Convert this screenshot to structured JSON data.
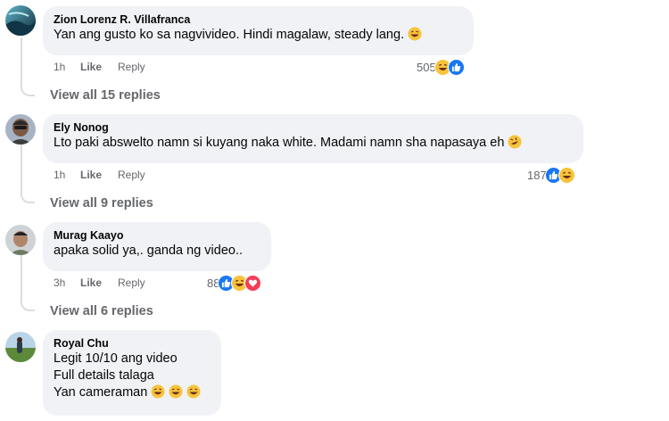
{
  "comments": [
    {
      "author": "Zion Lorenz R. Villafranca",
      "lines": [
        "Yan ang gusto ko sa nagvivideo. Hindi magalaw, steady lang."
      ],
      "time": "1h",
      "like_label": "Like",
      "reply_label": "Reply",
      "reaction_count": "505",
      "reactions": [
        "haha",
        "like"
      ],
      "view_replies": "View all 15 replies"
    },
    {
      "author": "Ely Nonog",
      "lines": [
        "Lto paki abswelto namn si kuyang naka white. Madami namn sha napasaya eh"
      ],
      "time": "1h",
      "like_label": "Like",
      "reply_label": "Reply",
      "reaction_count": "187",
      "reactions": [
        "like",
        "haha"
      ],
      "view_replies": "View all 9 replies"
    },
    {
      "author": "Murag Kaayo",
      "lines": [
        "apaka solid ya,. ganda ng video.."
      ],
      "time": "3h",
      "like_label": "Like",
      "reply_label": "Reply",
      "reaction_count": "88",
      "reactions": [
        "like",
        "haha",
        "love"
      ],
      "view_replies": "View all 6 replies"
    },
    {
      "author": "Royal Chu",
      "lines": [
        "Legit 10/10 ang video",
        "Full details talaga",
        "Yan cameraman"
      ]
    }
  ],
  "colors": {
    "bubble": "#f0f2f5",
    "meta_text": "#65676b",
    "like_blue": "#1877f2",
    "haha_yellow": "#f7c33b",
    "love_red": "#f33e58"
  }
}
